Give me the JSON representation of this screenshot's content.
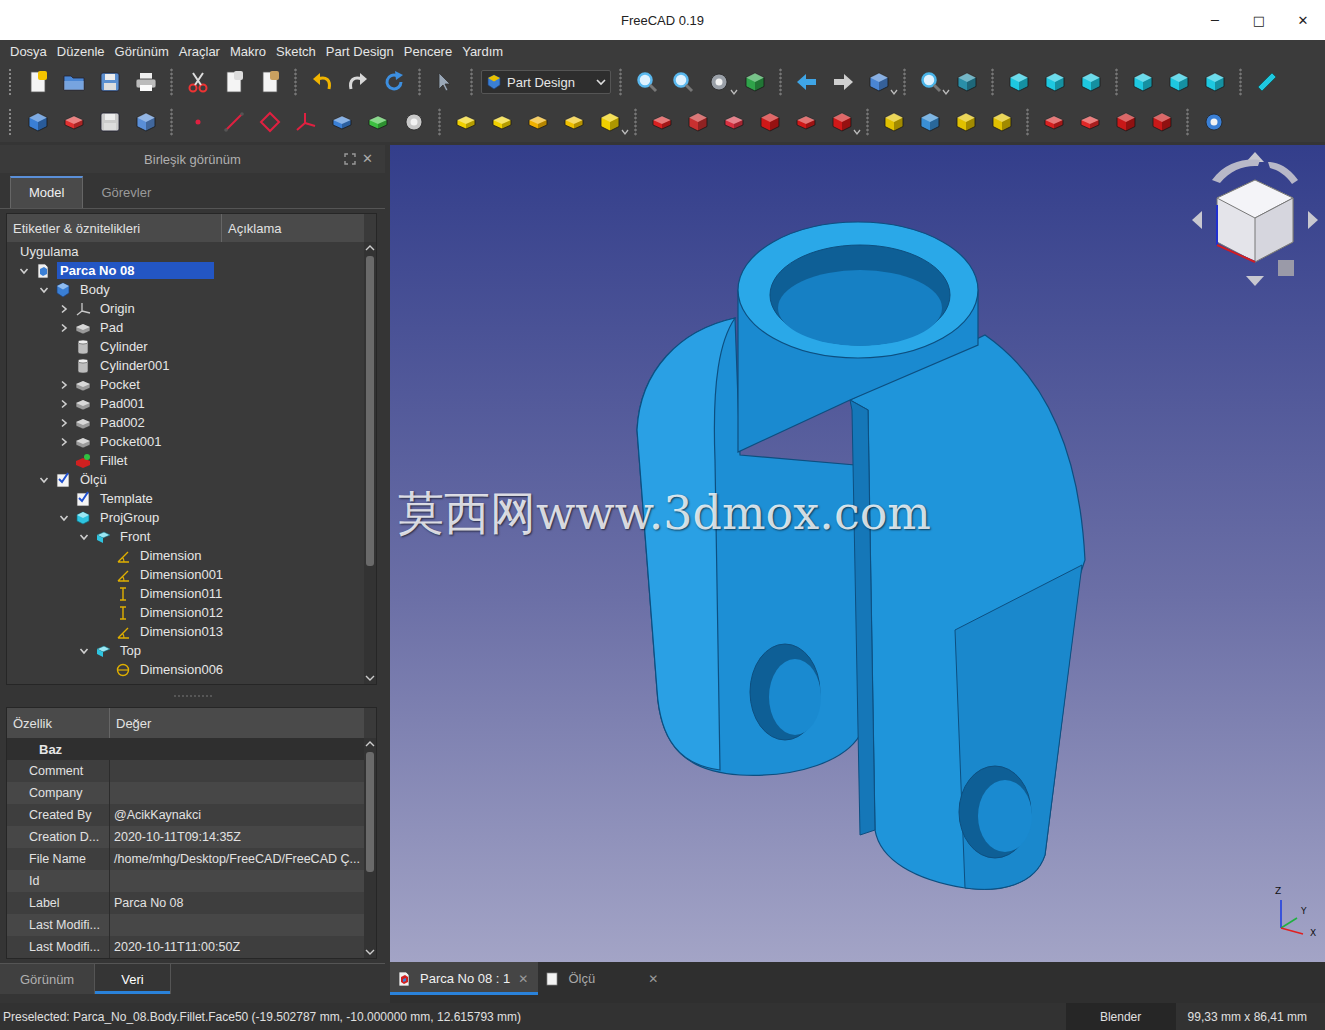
{
  "window": {
    "title": "FreeCAD 0.19",
    "controls": [
      "─",
      "□",
      "✕"
    ]
  },
  "menu": [
    "Dosya",
    "Düzenle",
    "Görünüm",
    "Araçlar",
    "Makro",
    "Sketch",
    "Part Design",
    "Pencere",
    "Yardım"
  ],
  "workbench": {
    "label": "Part Design"
  },
  "combo_view": {
    "title": "Birleşik görünüm",
    "close": "✕",
    "tabs": [
      {
        "label": "Model",
        "selected": true
      },
      {
        "label": "Görevler",
        "selected": false
      }
    ],
    "tree": {
      "columns": [
        "Etiketler & öznitelikleri",
        "Açıklama"
      ],
      "rows": [
        {
          "label": "Uygulama",
          "depth": 0,
          "expandable": false,
          "expanded": false,
          "selected": false,
          "kind": "section"
        },
        {
          "label": "Parca No 08",
          "depth": 0,
          "expandable": true,
          "expanded": true,
          "selected": true,
          "kind": "document"
        },
        {
          "label": "Body",
          "depth": 1,
          "expandable": true,
          "expanded": true,
          "selected": false,
          "kind": "body"
        },
        {
          "label": "Origin",
          "depth": 2,
          "expandable": true,
          "expanded": false,
          "selected": false,
          "kind": "origin"
        },
        {
          "label": "Pad",
          "depth": 2,
          "expandable": true,
          "expanded": false,
          "selected": false,
          "kind": "feature"
        },
        {
          "label": "Cylinder",
          "depth": 2,
          "expandable": false,
          "expanded": false,
          "selected": false,
          "kind": "cylinder"
        },
        {
          "label": "Cylinder001",
          "depth": 2,
          "expandable": false,
          "expanded": false,
          "selected": false,
          "kind": "cylinder"
        },
        {
          "label": "Pocket",
          "depth": 2,
          "expandable": true,
          "expanded": false,
          "selected": false,
          "kind": "feature"
        },
        {
          "label": "Pad001",
          "depth": 2,
          "expandable": true,
          "expanded": false,
          "selected": false,
          "kind": "feature"
        },
        {
          "label": "Pad002",
          "depth": 2,
          "expandable": true,
          "expanded": false,
          "selected": false,
          "kind": "feature"
        },
        {
          "label": "Pocket001",
          "depth": 2,
          "expandable": true,
          "expanded": false,
          "selected": false,
          "kind": "feature"
        },
        {
          "label": "Fillet",
          "depth": 2,
          "expandable": false,
          "expanded": false,
          "selected": false,
          "kind": "fillet"
        },
        {
          "label": "Ölçü",
          "depth": 1,
          "expandable": true,
          "expanded": true,
          "selected": false,
          "kind": "drawing"
        },
        {
          "label": "Template",
          "depth": 2,
          "expandable": false,
          "expanded": false,
          "selected": false,
          "kind": "drawing"
        },
        {
          "label": "ProjGroup",
          "depth": 2,
          "expandable": true,
          "expanded": true,
          "selected": false,
          "kind": "projgroup"
        },
        {
          "label": "Front",
          "depth": 3,
          "expandable": true,
          "expanded": true,
          "selected": false,
          "kind": "view"
        },
        {
          "label": "Dimension",
          "depth": 4,
          "expandable": false,
          "expanded": false,
          "selected": false,
          "kind": "dim-angle"
        },
        {
          "label": "Dimension001",
          "depth": 4,
          "expandable": false,
          "expanded": false,
          "selected": false,
          "kind": "dim-angle"
        },
        {
          "label": "Dimension011",
          "depth": 4,
          "expandable": false,
          "expanded": false,
          "selected": false,
          "kind": "dim-length"
        },
        {
          "label": "Dimension012",
          "depth": 4,
          "expandable": false,
          "expanded": false,
          "selected": false,
          "kind": "dim-length"
        },
        {
          "label": "Dimension013",
          "depth": 4,
          "expandable": false,
          "expanded": false,
          "selected": false,
          "kind": "dim-angle"
        },
        {
          "label": "Top",
          "depth": 3,
          "expandable": true,
          "expanded": true,
          "selected": false,
          "kind": "view"
        },
        {
          "label": "Dimension006",
          "depth": 4,
          "expandable": false,
          "expanded": false,
          "selected": false,
          "kind": "dim-diameter"
        }
      ]
    },
    "properties": {
      "columns": [
        "Özellik",
        "Değer"
      ],
      "group": "Baz",
      "rows": [
        {
          "name": "Comment",
          "value": ""
        },
        {
          "name": "Company",
          "value": ""
        },
        {
          "name": "Created By",
          "value": "@AcikKaynakci"
        },
        {
          "name": "Creation D...",
          "value": "2020-10-11T09:14:35Z"
        },
        {
          "name": "File Name",
          "value": "/home/mhg/Desktop/FreeCAD/FreeCAD Ç..."
        },
        {
          "name": "Id",
          "value": ""
        },
        {
          "name": "Label",
          "value": "Parca No 08"
        },
        {
          "name": "Last Modifi...",
          "value": ""
        },
        {
          "name": "Last Modifi...",
          "value": "2020-10-11T11:00:50Z"
        }
      ]
    },
    "bottom_tabs": [
      {
        "label": "Görünüm",
        "selected": false
      },
      {
        "label": "Veri",
        "selected": true
      }
    ]
  },
  "viewport": {
    "watermark": "莫西网www.3dmox.com",
    "axes": [
      "Z",
      "Y",
      "X"
    ]
  },
  "document_tabs": [
    {
      "label": "Parca No 08 : 1",
      "selected": true,
      "close": "✕",
      "kind": "model"
    },
    {
      "label": "Ölçü",
      "selected": false,
      "close": "✕",
      "kind": "page"
    }
  ],
  "status_bar": {
    "message": "Preselected: Parca_No_08.Body.Fillet.Face50 (-19.502787 mm, -10.000000 mm, 12.615793 mm)",
    "navigation": "Blender",
    "dimensions": "99,33 mm x 86,41 mm"
  }
}
